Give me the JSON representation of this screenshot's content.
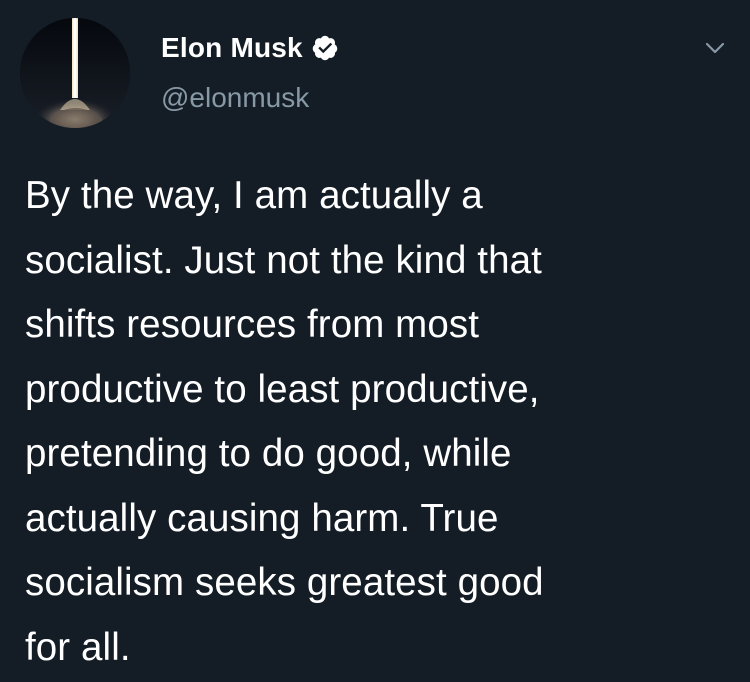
{
  "tweet": {
    "author": {
      "display_name": "Elon Musk",
      "handle": "@elonmusk",
      "verified": true,
      "avatar_icon": "rocket-launch-avatar"
    },
    "text": "By the way, I am actually a\nsocialist. Just not the kind that\nshifts resources from most\nproductive to least productive,\npretending to do good, while\nactually causing harm. True\nsocialism seeks greatest good\nfor all.",
    "menu_icon": "chevron-down-icon"
  },
  "colors": {
    "background": "#141d26",
    "text": "#ffffff",
    "secondary_text": "#8899a6",
    "caret": "#8899a6"
  }
}
